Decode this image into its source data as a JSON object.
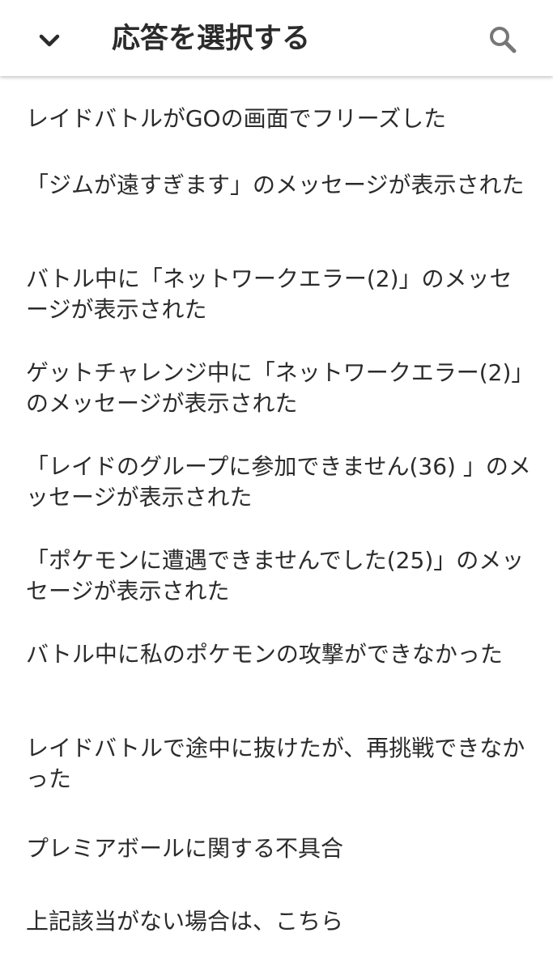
{
  "header": {
    "title": "応答を選択する"
  },
  "options": [
    "レイドバトルがGOの画面でフリーズした",
    "「ジムが遠すぎます」のメッセージが表示された",
    "バトル中に「ネットワークエラー(2)」のメッセージが表示された",
    "ゲットチャレンジ中に「ネットワークエラー(2)」のメッセージが表示された",
    "「レイドのグループに参加できません(36) 」のメッセージが表示された",
    "「ポケモンに遭遇できませんでした(25)」のメッセージが表示された",
    "バトル中に私のポケモンの攻撃ができなかった",
    "レイドバトルで途中に抜けたが、再挑戦できなかった",
    "プレミアボールに関する不具合",
    "上記該当がない場合は、こちら"
  ]
}
